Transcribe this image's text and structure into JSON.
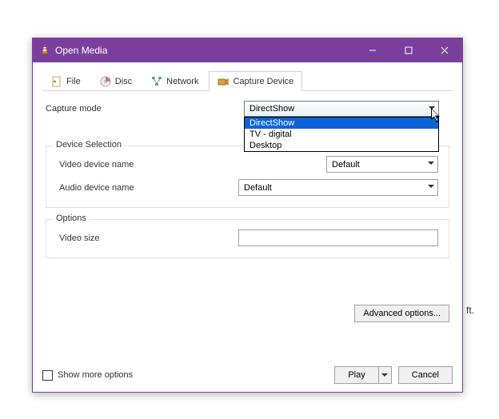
{
  "window": {
    "title": "Open Media"
  },
  "tabs": {
    "file": "File",
    "disc": "Disc",
    "network": "Network",
    "capture": "Capture Device"
  },
  "capture": {
    "mode_label": "Capture mode",
    "mode_value": "DirectShow",
    "mode_options": [
      "DirectShow",
      "TV - digital",
      "Desktop"
    ],
    "device_selection_title": "Device Selection",
    "video_device_label": "Video device name",
    "video_device_value": "Default",
    "audio_device_label": "Audio device name",
    "audio_device_value": "Default",
    "options_title": "Options",
    "video_size_label": "Video size",
    "video_size_value": "",
    "advanced_btn": "Advanced options..."
  },
  "footer": {
    "show_more": "Show more options",
    "play": "Play",
    "cancel": "Cancel"
  },
  "stray_text": "ft.",
  "colors": {
    "accent": "#7a3f9d",
    "selection": "#0a64d8"
  }
}
